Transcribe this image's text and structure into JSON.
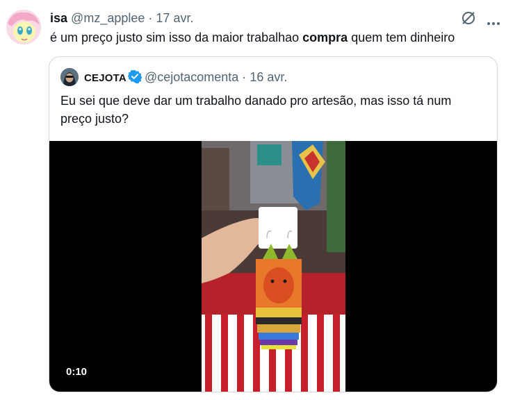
{
  "tweet": {
    "display_name": "isa",
    "handle": "@mz_applee",
    "separator": "·",
    "date": "17 avr.",
    "text_before": "é um preço justo sim isso da maior trabalhao ",
    "text_bold": "compra",
    "text_after": " quem tem dinheiro"
  },
  "quoted": {
    "display_name": "CEJOTA",
    "handle": "@cejotacomenta",
    "separator": "·",
    "date": "16 avr.",
    "text": "Eu sei que deve dar um trabalho danado pro artesão, mas isso tá num preço justo?",
    "video_time": "0:10"
  },
  "icons": {
    "grok": "grok-icon",
    "more": "more-icon",
    "verified": "verified-badge-icon"
  },
  "colors": {
    "verified_blue": "#1d9bf0",
    "muted": "#536471",
    "border": "#cfd9de"
  }
}
